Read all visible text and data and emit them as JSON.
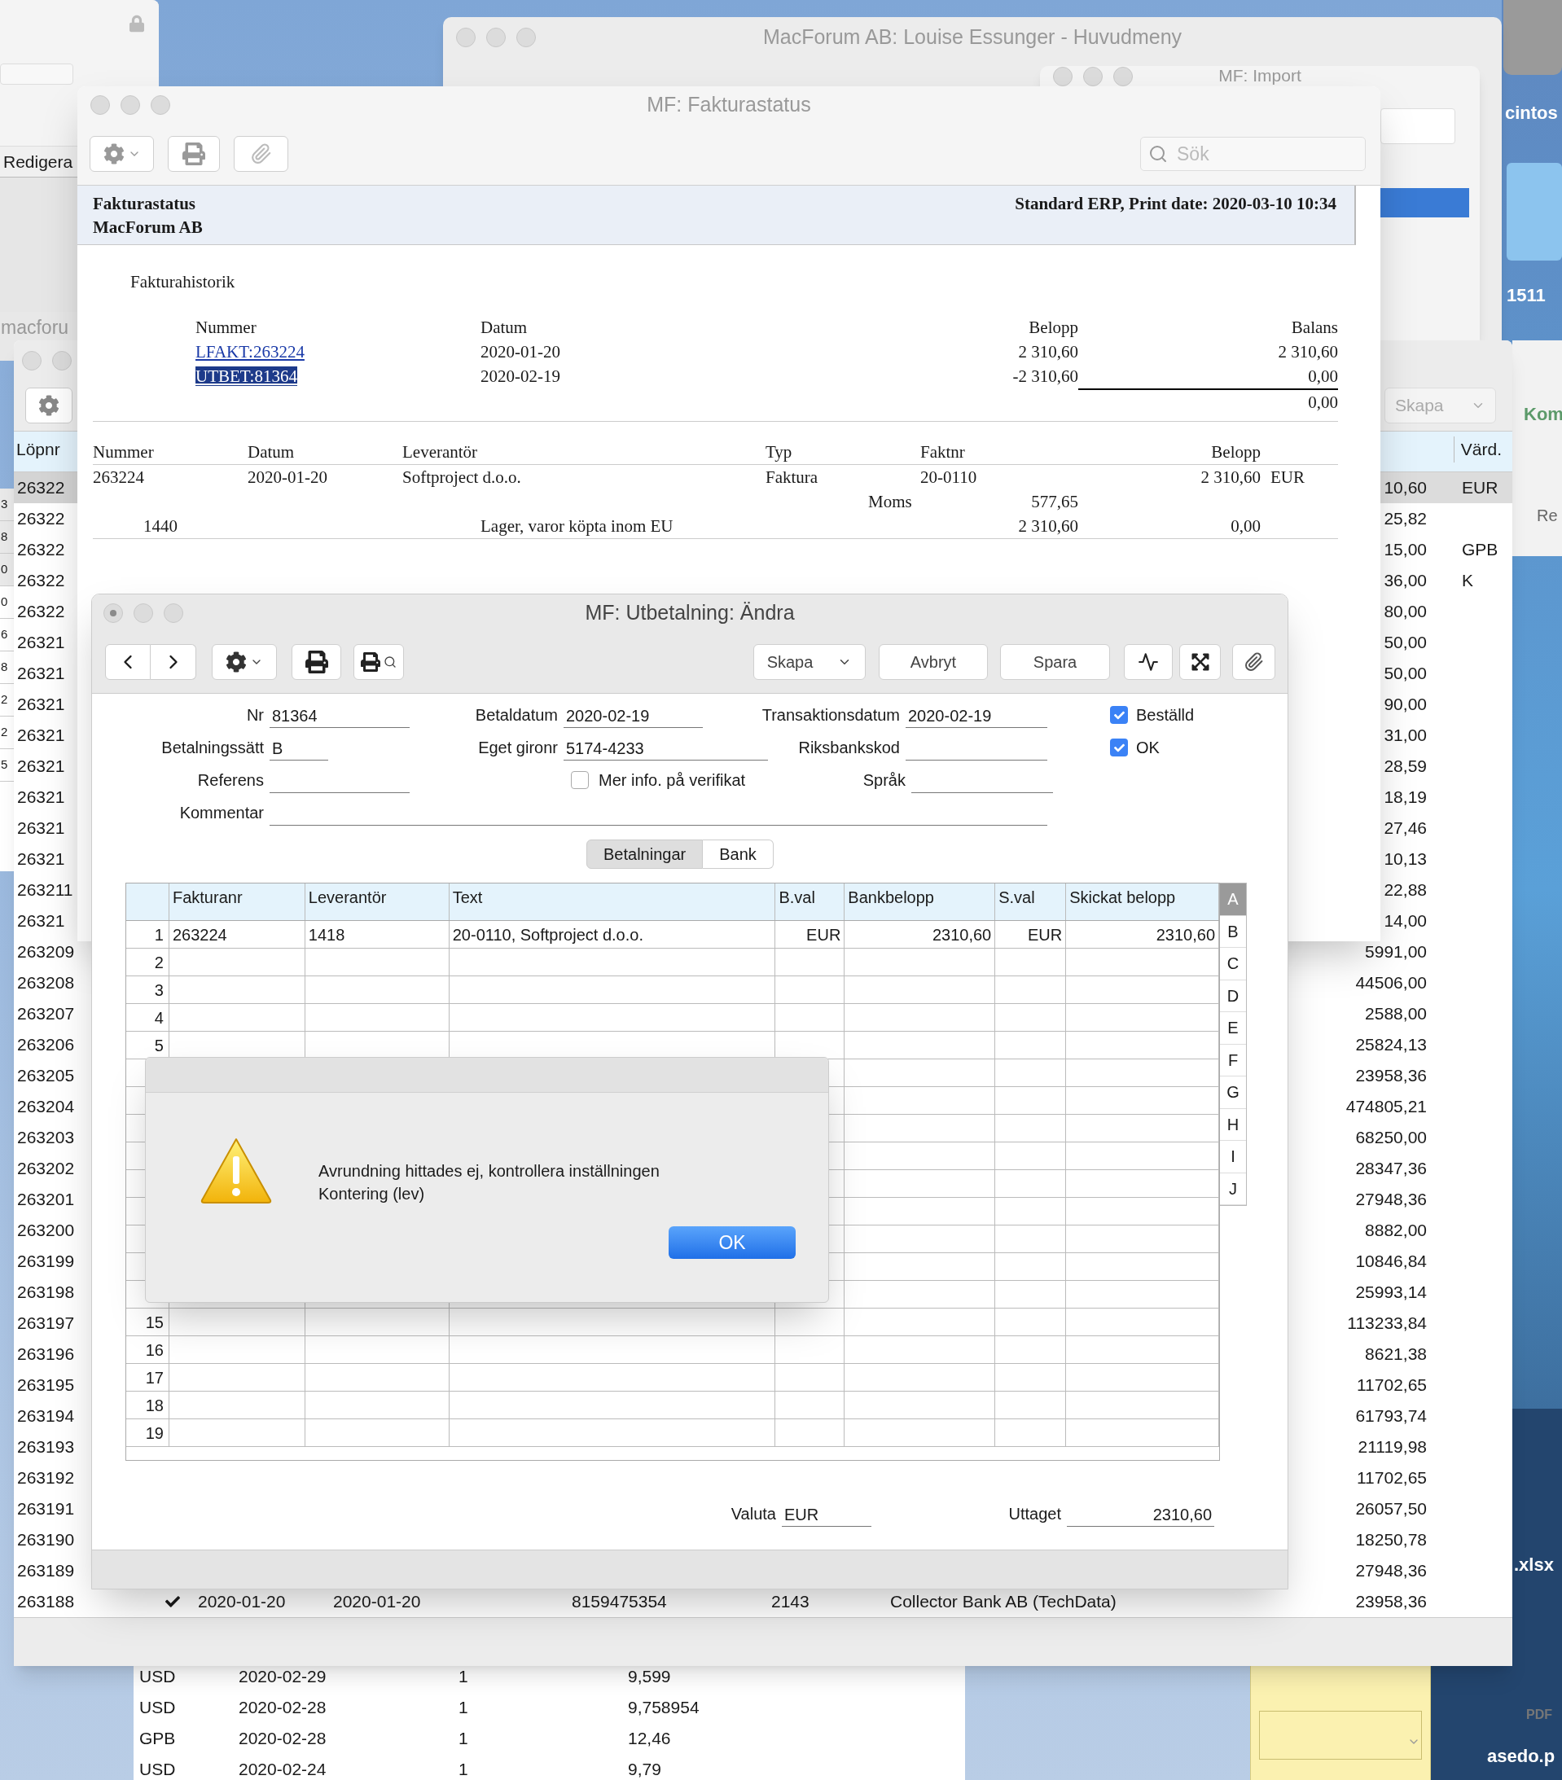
{
  "desktop": {
    "icons": [
      {
        "label": "cintos"
      },
      {
        "label": "1511"
      },
      {
        "label": ".xlsx"
      },
      {
        "label": "PDF"
      },
      {
        "label": "asedo.p"
      }
    ]
  },
  "edit_window": {
    "tab": "Redigera"
  },
  "main_menu": {
    "title": "MacForum AB: Louise Essunger - Huvudmeny"
  },
  "import_window": {
    "title": "MF: Import"
  },
  "macforum_window": {
    "title": "macforu"
  },
  "right_window": {
    "label": "Kom",
    "button": "Re"
  },
  "left_window": {
    "marks": [
      "3",
      "8",
      "0",
      "0",
      "6",
      "8",
      "2",
      "2",
      "5"
    ]
  },
  "list_window": {
    "create_button": "Skapa",
    "columns": [
      "Löpnr",
      "Värd."
    ],
    "rows": [
      {
        "kind": "plain",
        "number": "26322",
        "amount": "10,60",
        "currency": "EUR",
        "selected": true
      },
      {
        "kind": "plain",
        "number": "26322",
        "amount": "25,82",
        "selected": false
      },
      {
        "kind": "plain",
        "number": "26322",
        "amount": "15,00",
        "currency": "GPB",
        "selected": false
      },
      {
        "kind": "plain",
        "number": "26322",
        "amount": "36,00",
        "currency": "K",
        "selected": false
      },
      {
        "kind": "plain",
        "number": "26322",
        "amount": "80,00",
        "selected": false
      },
      {
        "kind": "plain",
        "number": "26321",
        "amount": "50,00",
        "selected": false
      },
      {
        "kind": "plain",
        "number": "26321",
        "amount": "50,00",
        "selected": false
      },
      {
        "kind": "plain",
        "number": "26321",
        "amount": "90,00",
        "selected": false
      },
      {
        "kind": "plain",
        "number": "26321",
        "amount": "31,00",
        "selected": false
      },
      {
        "kind": "plain",
        "number": "26321",
        "amount": "28,59",
        "selected": false
      },
      {
        "kind": "plain",
        "number": "26321",
        "amount": "18,19",
        "selected": false
      },
      {
        "kind": "plain",
        "number": "26321",
        "amount": "27,46",
        "selected": false
      },
      {
        "kind": "plain",
        "number": "26321",
        "amount": "10,13",
        "selected": false
      },
      {
        "kind": "plain",
        "number": "263211",
        "amount": "22,88",
        "selected": false
      },
      {
        "kind": "plain",
        "number": "26321",
        "amount": "14,00",
        "selected": false
      },
      {
        "kind": "plain",
        "number": "263209",
        "amount": "5991,00",
        "selected": false
      },
      {
        "kind": "plain",
        "number": "263208",
        "amount": "44506,00",
        "selected": false
      },
      {
        "kind": "plain",
        "number": "263207",
        "amount": "2588,00",
        "selected": false
      },
      {
        "kind": "plain",
        "number": "263206",
        "amount": "25824,13",
        "selected": false
      },
      {
        "kind": "plain",
        "number": "263205",
        "amount": "23958,36",
        "selected": false
      },
      {
        "kind": "plain",
        "number": "263204",
        "amount": "474805,21",
        "selected": false
      },
      {
        "kind": "plain",
        "number": "263203",
        "amount": "68250,00",
        "selected": false
      },
      {
        "kind": "plain",
        "number": "263202",
        "amount": "28347,36",
        "selected": false
      },
      {
        "kind": "plain",
        "number": "263201",
        "amount": "27948,36",
        "selected": false
      },
      {
        "kind": "plain",
        "number": "263200",
        "amount": "8882,00",
        "selected": false
      },
      {
        "kind": "plain",
        "number": "263199",
        "amount": "10846,84",
        "selected": false
      },
      {
        "kind": "plain",
        "number": "263198",
        "amount": "25993,14",
        "selected": false
      },
      {
        "kind": "plain",
        "number": "263197",
        "amount": "113233,84",
        "selected": false
      },
      {
        "kind": "plain",
        "number": "263196",
        "amount": "8621,38",
        "selected": false
      },
      {
        "kind": "plain",
        "number": "263195",
        "amount": "11702,65",
        "selected": false
      },
      {
        "kind": "plain",
        "number": "263194",
        "amount": "61793,74",
        "selected": false
      },
      {
        "kind": "plain",
        "number": "263193",
        "amount": "21119,98",
        "selected": false
      },
      {
        "kind": "plain",
        "number": "263192",
        "amount": "11702,65",
        "selected": false
      },
      {
        "kind": "plain",
        "number": "263191",
        "amount": "26057,50",
        "selected": false
      },
      {
        "kind": "plain",
        "number": "263190",
        "amount": "18250,78",
        "selected": false
      },
      {
        "kind": "plain",
        "number": "263189",
        "amount": "27948,36",
        "selected": false
      },
      {
        "kind": "full",
        "number": "263188",
        "checked": true,
        "date": "2020-01-20",
        "due_date": "2020-01-20",
        "reference": "8159475354",
        "account": "2143",
        "payee": "Collector Bank AB (TechData)",
        "amount": "23958,36",
        "selected": false
      }
    ]
  },
  "currency_window": {
    "rows": [
      {
        "currency": "USD",
        "date": "2020-02-29",
        "units": "1",
        "rate": "9,599"
      },
      {
        "currency": "USD",
        "date": "2020-02-28",
        "units": "1",
        "rate": "9,758954"
      },
      {
        "currency": "GPB",
        "date": "2020-02-28",
        "units": "1",
        "rate": "12,46"
      },
      {
        "currency": "USD",
        "date": "2020-02-24",
        "units": "1",
        "rate": "9,79"
      }
    ]
  },
  "fakturastatus": {
    "title": "MF: Fakturastatus",
    "search": {
      "placeholder": "Sök"
    },
    "header": {
      "title": "Fakturastatus",
      "company": "MacForum AB",
      "info": "Standard ERP, Print date: 2020-03-10 10:34"
    },
    "section": "Fakturahistorik",
    "history": {
      "columns": [
        "Nummer",
        "Datum",
        "Belopp",
        "Balans"
      ],
      "rows": [
        {
          "kind": "link",
          "number": "LFAKT:263224",
          "date": "2020-01-20",
          "amount": "2 310,60",
          "balance": "2 310,60"
        },
        {
          "kind": "highlighted",
          "number": "UTBET:81364",
          "date": "2020-02-19",
          "amount": "-2 310,60",
          "balance": "0,00"
        }
      ],
      "total": "0,00"
    },
    "invoice": {
      "columns": [
        "Nummer",
        "Datum",
        "Leverantör",
        "Typ",
        "Faktnr",
        "Belopp"
      ],
      "row": {
        "number": "263224",
        "date": "2020-01-20",
        "supplier": "Softproject d.o.o.",
        "type": "Faktura",
        "invoice_no": "20-0110",
        "amount": "2 310,60",
        "currency": "EUR"
      },
      "vat": {
        "label": "Moms",
        "amount": "577,65"
      },
      "account": {
        "number": "1440",
        "name": "Lager, varor köpta inom EU",
        "amount": "2 310,60",
        "balance": "0,00"
      }
    }
  },
  "payment": {
    "title": "MF: Utbetalning: Ändra",
    "toolbar": {
      "create": "Skapa",
      "cancel": "Avbryt",
      "save": "Spara"
    },
    "fields": {
      "nr": {
        "label": "Nr",
        "value": "81364"
      },
      "betaldatum": {
        "label": "Betaldatum",
        "value": "2020-02-19"
      },
      "transaktionsdatum": {
        "label": "Transaktionsdatum",
        "value": "2020-02-19"
      },
      "betalningssatt": {
        "label": "Betalningssätt",
        "value": "B"
      },
      "gironr": {
        "label": "Eget gironr",
        "value": "5174-4233"
      },
      "riksbankskod": {
        "label": "Riksbankskod"
      },
      "referens": {
        "label": "Referens"
      },
      "sprak": {
        "label": "Språk"
      },
      "kommentar": {
        "label": "Kommentar"
      }
    },
    "checkboxes": [
      {
        "label": "Beställd",
        "checked": true
      },
      {
        "label": "OK",
        "checked": true
      }
    ],
    "more_info": {
      "label": "Mer info. på verifikat",
      "checked": false
    },
    "tabs": [
      {
        "label": "Betalningar",
        "selected": true
      },
      {
        "label": "Bank",
        "selected": false
      }
    ],
    "grid": {
      "columns": [
        "Fakturanr",
        "Leverantör",
        "Text",
        "B.val",
        "Bankbelopp",
        "S.val",
        "Skickat belopp"
      ],
      "rows": [
        {
          "number": "1",
          "cells": [
            "263224",
            "1418",
            "20-0110, Softproject d.o.o.",
            "EUR",
            "2310,60",
            "EUR",
            "2310,60"
          ]
        },
        {
          "number": "2"
        },
        {
          "number": "3"
        },
        {
          "number": "4"
        },
        {
          "number": "5"
        },
        {},
        {},
        {},
        {},
        {},
        {},
        {},
        {},
        {},
        {
          "number": "15"
        },
        {
          "number": "16"
        },
        {
          "number": "17"
        },
        {
          "number": "18"
        },
        {
          "number": "19"
        }
      ]
    },
    "index": [
      {
        "label": "A",
        "selected": true
      },
      {
        "label": "B",
        "selected": false
      },
      {
        "label": "C",
        "selected": false
      },
      {
        "label": "D",
        "selected": false
      },
      {
        "label": "E",
        "selected": false
      },
      {
        "label": "F",
        "selected": false
      },
      {
        "label": "G",
        "selected": false
      },
      {
        "label": "H",
        "selected": false
      },
      {
        "label": "I",
        "selected": false
      },
      {
        "label": "J",
        "selected": false
      }
    ],
    "valuta": {
      "label": "Valuta",
      "value": "EUR"
    },
    "uttaget": {
      "label": "Uttaget",
      "value": "2310,60"
    }
  },
  "alert": {
    "message": "Avrundning hittades ej, kontrollera inställningen\nKontering (lev)",
    "button": "OK"
  }
}
